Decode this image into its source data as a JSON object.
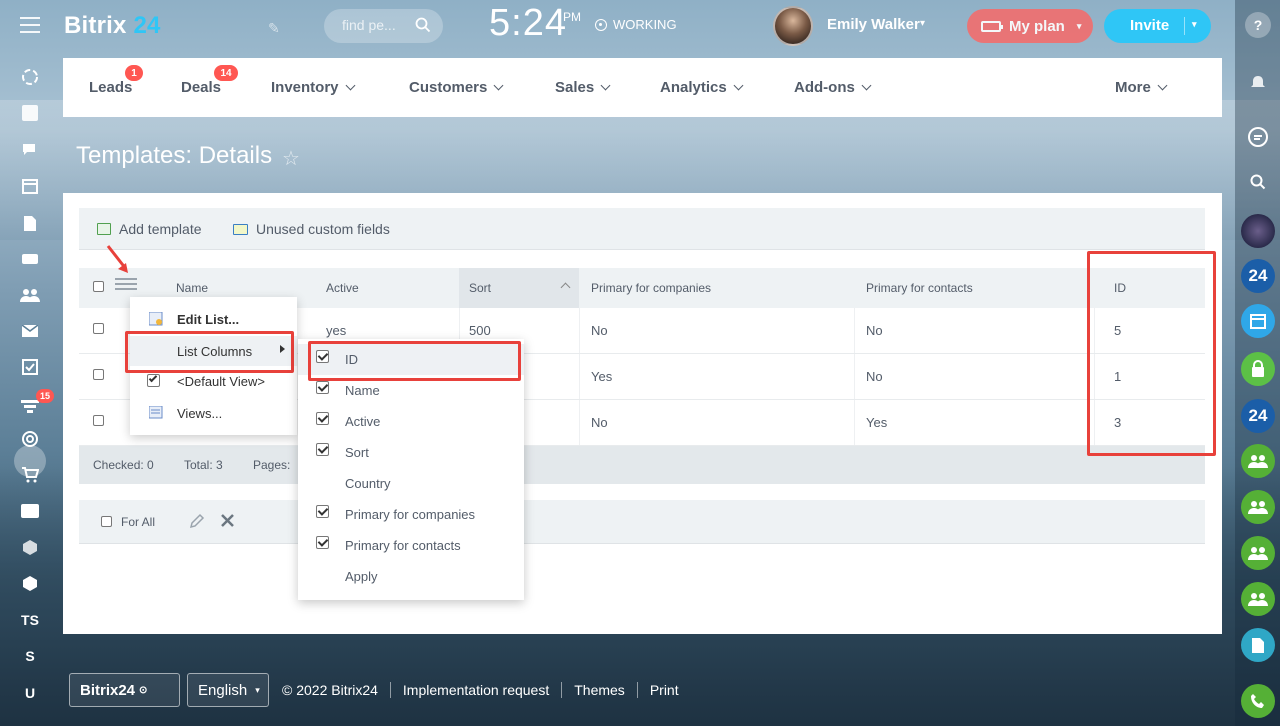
{
  "header": {
    "logo_text": "Bitrix",
    "logo_num": "24",
    "search_placeholder": "find pe...",
    "clock": "5:24",
    "clock_ampm": "PM",
    "status": "WORKING",
    "user_name": "Emily Walker",
    "plan_label": "My plan",
    "invite_label": "Invite"
  },
  "left_sidebar": {
    "badge": "15",
    "text_items": [
      "TS",
      "S",
      "U"
    ]
  },
  "nav": {
    "items": [
      {
        "label": "Leads",
        "badge": "1"
      },
      {
        "label": "Deals",
        "badge": "14"
      },
      {
        "label": "Inventory"
      },
      {
        "label": "Customers"
      },
      {
        "label": "Sales"
      },
      {
        "label": "Analytics"
      },
      {
        "label": "Add-ons"
      },
      {
        "label": "More"
      }
    ]
  },
  "page": {
    "title": "Templates: Details"
  },
  "toolbar": {
    "add_template": "Add template",
    "unused_fields": "Unused custom fields"
  },
  "grid": {
    "columns": [
      "Name",
      "Active",
      "Sort",
      "Primary for companies",
      "Primary for contacts",
      "ID"
    ],
    "rows": [
      {
        "active": "yes",
        "sort": "500",
        "primary_companies": "No",
        "primary_contacts": "No",
        "id": "5"
      },
      {
        "active": "",
        "sort": "",
        "primary_companies": "Yes",
        "primary_contacts": "No",
        "id": "1"
      },
      {
        "active": "",
        "sort": "",
        "primary_companies": "No",
        "primary_contacts": "Yes",
        "id": "3"
      }
    ],
    "footer": {
      "checked": "Checked: 0",
      "total": "Total: 3",
      "pages": "Pages:"
    },
    "for_all": "For All"
  },
  "settings_menu": {
    "edit_list": "Edit List...",
    "list_columns": "List Columns",
    "default_view": "<Default View>",
    "views": "Views..."
  },
  "columns_menu": {
    "items": [
      {
        "label": "ID",
        "checked": true
      },
      {
        "label": "Name",
        "checked": true
      },
      {
        "label": "Active",
        "checked": true
      },
      {
        "label": "Sort",
        "checked": true
      },
      {
        "label": "Country",
        "checked": false
      },
      {
        "label": "Primary for companies",
        "checked": true
      },
      {
        "label": "Primary for contacts",
        "checked": true
      }
    ],
    "apply": "Apply"
  },
  "right_sidebar": {
    "items": [
      "help-icon",
      "bell-icon",
      "chat-icon",
      "search-icon",
      "avatar",
      "bitrix24-icon",
      "calendar-icon",
      "lock-icon",
      "bitrix24-icon",
      "group-icon",
      "group-icon",
      "group-icon",
      "group-icon",
      "file-icon",
      "phone-icon"
    ]
  },
  "footer": {
    "brand": "Bitrix24",
    "language": "English",
    "copyright": "© 2022 Bitrix24",
    "implementation": "Implementation request",
    "themes": "Themes",
    "print": "Print"
  },
  "colors": {
    "accent_blue": "#2fc6f6",
    "plan_red": "#f26e6e",
    "highlight_red": "#e8413b",
    "badge_red": "#ff5752"
  }
}
